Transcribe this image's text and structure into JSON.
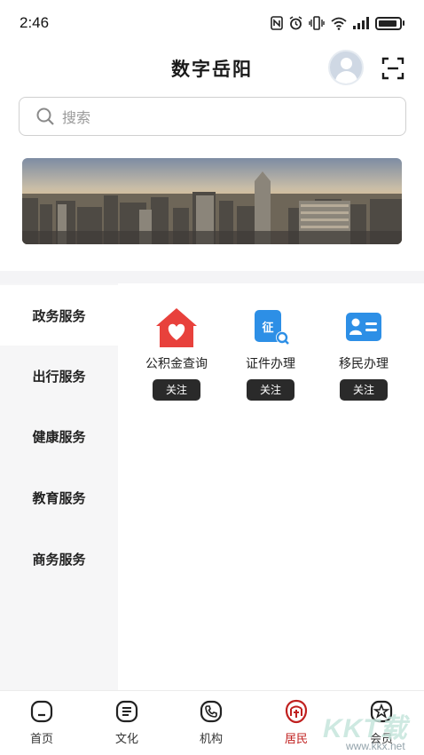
{
  "status_bar": {
    "time": "2:46",
    "icons": [
      "nfc-icon",
      "alarm-icon",
      "vibrate-icon",
      "wifi-icon",
      "signal-icon",
      "battery-icon"
    ]
  },
  "header": {
    "title": "数字岳阳",
    "avatar_icon": "user-avatar-icon",
    "scan_icon": "scan-icon"
  },
  "search": {
    "placeholder": "搜索",
    "icon": "search-icon"
  },
  "banner": {
    "icon": "city-skyline-image"
  },
  "categories": [
    {
      "label": "政务服务",
      "active": true
    },
    {
      "label": "出行服务",
      "active": false
    },
    {
      "label": "健康服务",
      "active": false
    },
    {
      "label": "教育服务",
      "active": false
    },
    {
      "label": "商务服务",
      "active": false
    }
  ],
  "services": [
    {
      "label": "公积金查询",
      "follow": "关注",
      "icon": "housing-fund-icon",
      "color": "#e8413c"
    },
    {
      "label": "证件办理",
      "follow": "关注",
      "icon": "certificate-icon",
      "color": "#2d8fe6"
    },
    {
      "label": "移民办理",
      "follow": "关注",
      "icon": "id-card-icon",
      "color": "#2d8fe6"
    }
  ],
  "bottom_nav": [
    {
      "label": "首页",
      "icon": "home-icon",
      "active": false
    },
    {
      "label": "文化",
      "icon": "culture-icon",
      "active": false
    },
    {
      "label": "机构",
      "icon": "phone-icon",
      "active": false
    },
    {
      "label": "居民",
      "icon": "resident-icon",
      "active": true
    },
    {
      "label": "会员",
      "icon": "member-icon",
      "active": false
    }
  ],
  "watermark": {
    "logo_text": "KKT载",
    "url": "www.kkx.net"
  },
  "colors": {
    "accent": "#c0201f",
    "follow_button": "#2a2a2a",
    "sidebar_bg": "#f6f6f7"
  }
}
